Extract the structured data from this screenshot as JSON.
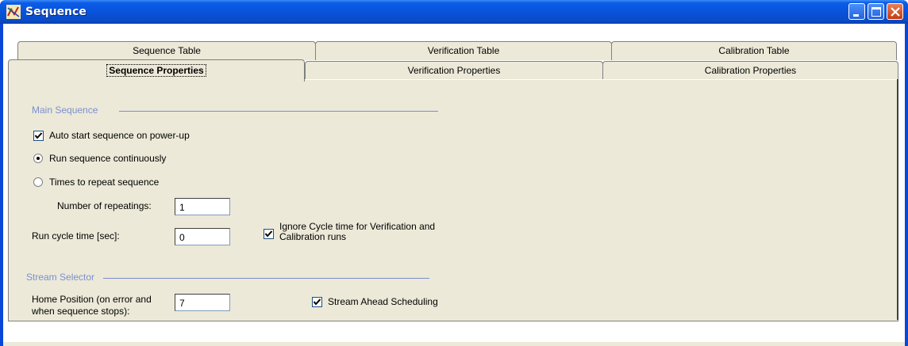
{
  "window": {
    "title": "Sequence",
    "colors": {
      "titlebar": "#0852d8",
      "panel": "#ece9d8",
      "group_heading": "#7b8fce"
    },
    "controls": {
      "minimize_icon": "minimize-icon",
      "maximize_icon": "maximize-icon",
      "close_icon": "close-icon"
    }
  },
  "tabs": {
    "row1": [
      "Sequence Table",
      "Verification Table",
      "Calibration Table"
    ],
    "row2": [
      "Sequence Properties",
      "Verification Properties",
      "Calibration Properties"
    ],
    "active": "Sequence Properties"
  },
  "main_sequence": {
    "heading": "Main Sequence",
    "auto_start": {
      "label": "Auto start sequence on power-up",
      "checked": true
    },
    "run_continuously": {
      "label": "Run sequence continuously",
      "selected": true
    },
    "times_to_repeat": {
      "label": "Times to repeat sequence",
      "selected": false
    },
    "number_of_repeatings": {
      "label": "Number of repeatings:",
      "value": "1"
    },
    "run_cycle_time": {
      "label": "Run cycle time [sec]:",
      "value": "0"
    },
    "ignore_cycle_time": {
      "label_line1": "Ignore Cycle time for Verification and",
      "label_line2": "Calibration runs",
      "checked": true
    }
  },
  "stream_selector": {
    "heading": "Stream Selector",
    "home_position": {
      "label_line1": "Home Position (on error and",
      "label_line2": "when sequence stops):",
      "value": "7"
    },
    "stream_ahead": {
      "label": "Stream Ahead Scheduling",
      "checked": true
    }
  }
}
